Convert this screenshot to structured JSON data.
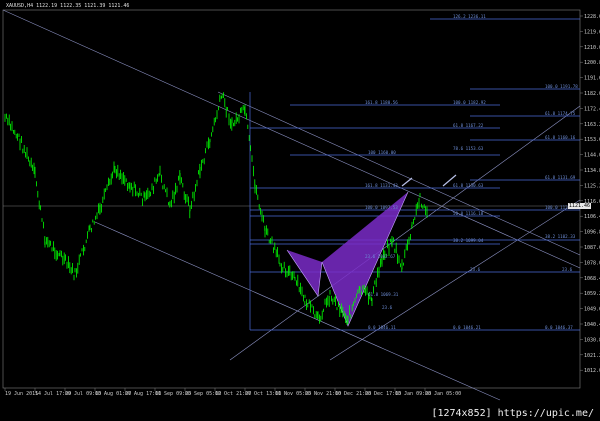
{
  "window": {
    "title": "XAUUSD,H4  1122.19 1122.35 1121.39 1121.46"
  },
  "price_axis": {
    "ticks": [
      "1228.66",
      "1219.65",
      "1210.05",
      "1200.85",
      "1191.65",
      "1182.05",
      "1172.45",
      "1163.26",
      "1153.66",
      "1144.06",
      "1134.86",
      "1125.26",
      "1116.06",
      "1106.46",
      "1096.86",
      "1087.67",
      "1078.07",
      "1068.47",
      "1059.27",
      "1049.67",
      "1040.48",
      "1030.88",
      "1021.28",
      "1012.08"
    ],
    "current_price": "1121.46"
  },
  "time_axis": {
    "ticks": [
      "19 Jun 2015",
      "14 Jul 17:00",
      "29 Jul 09:00",
      "13 Aug 01:00",
      "27 Aug 17:00",
      "11 Sep 09:00",
      "25 Sep 05:00",
      "12 Oct 21:00",
      "27 Oct 13:00",
      "11 Nov 05:00",
      "25 Nov 21:00",
      "10 Dec 21:00",
      "28 Dec 17:00",
      "13 Jan 09:00",
      "28 Jan 05:00"
    ]
  },
  "fib_labels": [
    {
      "text": "126.2 1236.11"
    },
    {
      "text": "100.0 1191.78"
    },
    {
      "text": "161.8 1180.56"
    },
    {
      "text": "100.0 1182.92"
    },
    {
      "text": "61.8 1174.75"
    },
    {
      "text": "61.8 1167.22"
    },
    {
      "text": "61.8 1160.16"
    },
    {
      "text": "100 1160.00"
    },
    {
      "text": "78.6 1153.63"
    },
    {
      "text": "61.8 1131.69"
    },
    {
      "text": "161.8 1131.43"
    },
    {
      "text": "61.8 1130.63"
    },
    {
      "text": "100.0 1121.21"
    },
    {
      "text": "50.0 1116.18"
    },
    {
      "text": "38.2 1102.33"
    },
    {
      "text": "38.2 1099.04"
    },
    {
      "text": "100.0 1097.53"
    },
    {
      "text": "23.6 1082.67"
    },
    {
      "text": "23.6"
    },
    {
      "text": "23.6"
    },
    {
      "text": "61.8 1069.31"
    },
    {
      "text": "23.6"
    },
    {
      "text": "0.0 1046.11"
    },
    {
      "text": "0.0 1046.21"
    },
    {
      "text": "0.0 1046.37"
    }
  ],
  "watermark": "[1274x852] https://upic.me/",
  "colors": {
    "background": "#000000",
    "candles": "#00ff00",
    "fib_lines": "#4a6ad8",
    "trend_lines": "#9aa0c8",
    "pattern_fill": "#7a2cc8",
    "grid": "#303030"
  }
}
